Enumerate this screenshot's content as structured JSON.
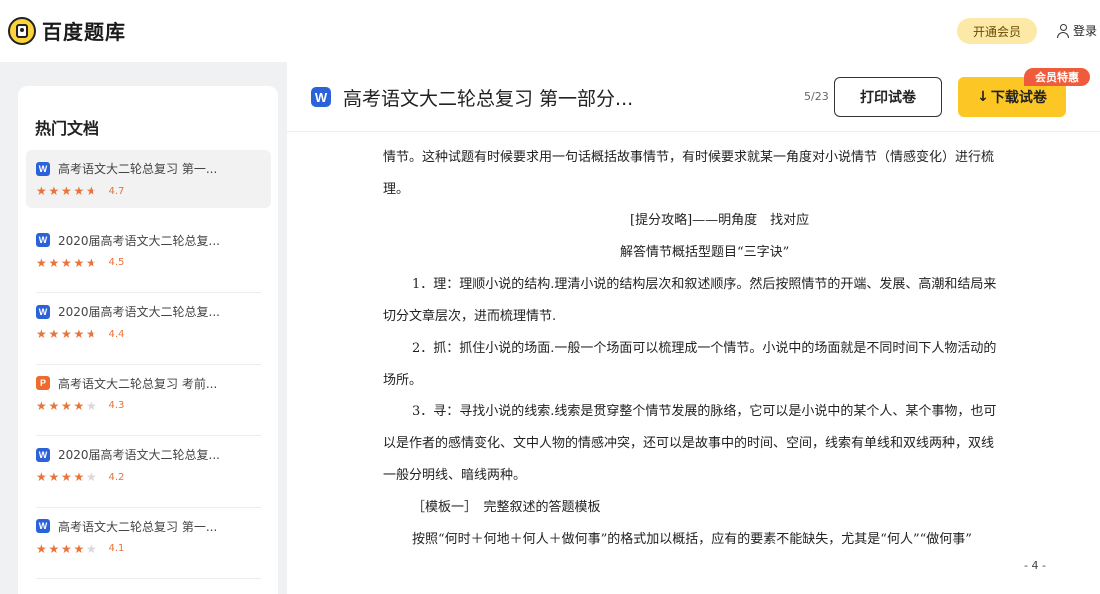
{
  "header": {
    "logo_text": "百度题库",
    "vip_label": "开通会员",
    "login_label": "登录"
  },
  "sidebar": {
    "title": "热门文档",
    "items": [
      {
        "type": "W",
        "name": "高考语文大二轮总复习 第一...",
        "score": "4.7",
        "stars": 4.5
      },
      {
        "type": "W",
        "name": "2020届高考语文大二轮总复...",
        "score": "4.5",
        "stars": 4.5
      },
      {
        "type": "W",
        "name": "2020届高考语文大二轮总复...",
        "score": "4.4",
        "stars": 4.5
      },
      {
        "type": "P",
        "name": "高考语文大二轮总复习 考前...",
        "score": "4.3",
        "stars": 4
      },
      {
        "type": "W",
        "name": "2020届高考语文大二轮总复...",
        "score": "4.2",
        "stars": 4
      },
      {
        "type": "W",
        "name": "高考语文大二轮总复习 第一...",
        "score": "4.1",
        "stars": 4
      }
    ]
  },
  "main": {
    "doc_type": "W",
    "title": "高考语文大二轮总复习 第一部分...",
    "page_indicator": "5/23",
    "print_label": "打印试卷",
    "download_label": "下载试卷",
    "download_arrow": "↓",
    "promo_tag": "会员特惠"
  },
  "document": {
    "lines": [
      "情节。这种试题有时候要求用一句话概括故事情节，有时候要求就某一角度对小说情节（情感变化）进行梳",
      "理。",
      "[提分攻略]——明角度　找对应",
      "解答情节概括型题目“三字诀”",
      "1．理：理顺小说的结构.理清小说的结构层次和叙述顺序。然后按照情节的开端、发展、高潮和结局来",
      "切分文章层次，进而梳理情节.",
      "2．抓：抓住小说的场面.一般一个场面可以梳理成一个情节。小说中的场面就是不同时间下人物活动的",
      "场所。",
      "3．寻：寻找小说的线索.线索是贯穿整个情节发展的脉络，它可以是小说中的某个人、某个事物，也可",
      "以是作者的感情变化、文中人物的情感冲突，还可以是故事中的时间、空间，线索有单线和双线两种，双线",
      "一般分明线、暗线两种。",
      "［模板一］　完整叙述的答题模板",
      "按照“何时＋何地＋何人＋做何事”的格式加以概括，应有的要素不能缺失，尤其是“何人”“做何事”"
    ],
    "page_number": "- 4 -"
  }
}
